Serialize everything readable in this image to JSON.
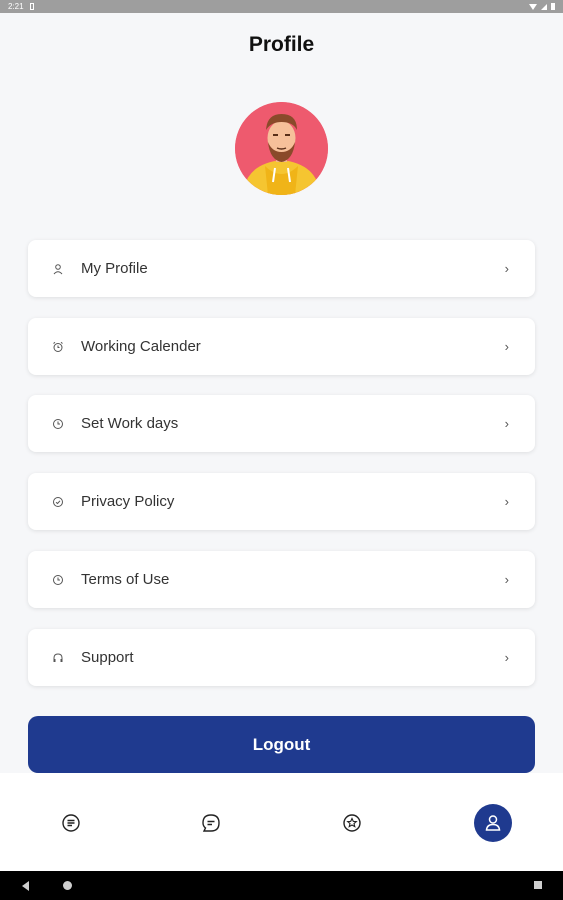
{
  "status_bar": {
    "time": "2:21"
  },
  "header": {
    "title": "Profile"
  },
  "menu": [
    {
      "label": "My Profile",
      "icon": "user-icon"
    },
    {
      "label": "Working Calender",
      "icon": "alarm-clock-icon"
    },
    {
      "label": "Set Work days",
      "icon": "clock-icon"
    },
    {
      "label": "Privacy Policy",
      "icon": "shield-check-icon"
    },
    {
      "label": "Terms of Use",
      "icon": "clock-icon"
    },
    {
      "label": "Support",
      "icon": "headphones-icon"
    }
  ],
  "chevron": "›",
  "logout_label": "Logout",
  "bottom_nav": [
    {
      "icon": "list-icon",
      "active": false
    },
    {
      "icon": "chat-icon",
      "active": false
    },
    {
      "icon": "star-badge-icon",
      "active": false
    },
    {
      "icon": "user-icon",
      "active": true
    }
  ],
  "colors": {
    "accent": "#1f3a8f",
    "background": "#f6f7f9",
    "avatar_bg": "#ee5a6e",
    "hoodie": "#f5c531"
  }
}
